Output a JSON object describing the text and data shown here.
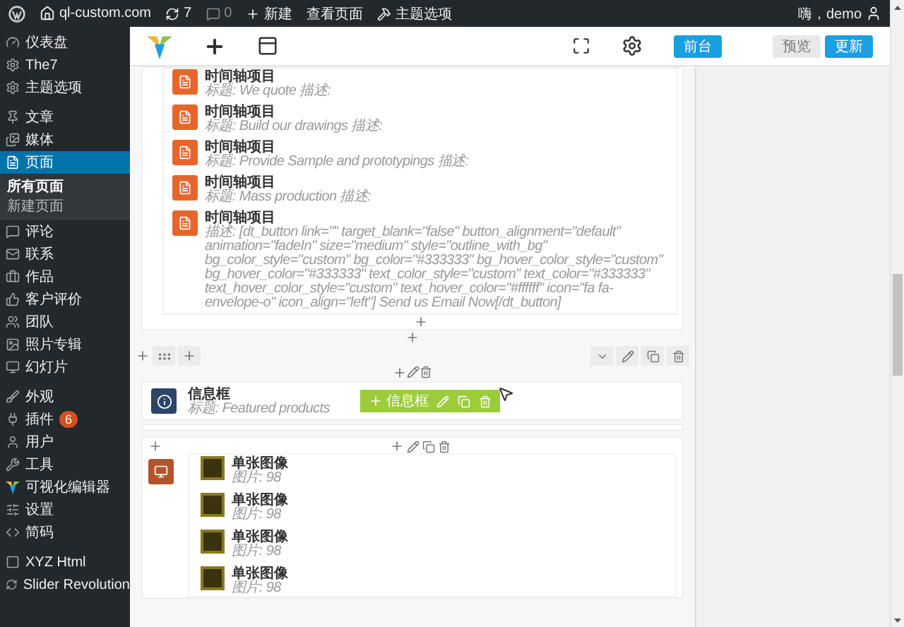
{
  "admin_bar": {
    "site": "ql-custom.com",
    "updates": "7",
    "comments": "0",
    "new": "新建",
    "view_page": "查看页面",
    "theme_options": "主题选项",
    "greeting": "嗨，demo"
  },
  "sidebar": {
    "groups": [
      {
        "items": [
          {
            "label": "仪表盘",
            "selected": false
          },
          {
            "label": "The7",
            "selected": false
          },
          {
            "label": "主题选项",
            "selected": false
          }
        ]
      },
      {
        "items": [
          {
            "label": "文章",
            "selected": false
          },
          {
            "label": "媒体",
            "selected": false
          },
          {
            "label": "页面",
            "selected": true,
            "children": [
              {
                "label": "所有页面",
                "selected": true
              },
              {
                "label": "新建页面",
                "selected": false
              }
            ]
          },
          {
            "label": "评论",
            "selected": false
          },
          {
            "label": "联系",
            "selected": false
          },
          {
            "label": "作品",
            "selected": false
          },
          {
            "label": "客户评价",
            "selected": false
          },
          {
            "label": "团队",
            "selected": false
          },
          {
            "label": "照片专辑",
            "selected": false
          },
          {
            "label": "幻灯片",
            "selected": false
          }
        ]
      },
      {
        "items": [
          {
            "label": "外观",
            "selected": false
          },
          {
            "label": "插件",
            "selected": false,
            "badge": "6"
          },
          {
            "label": "用户",
            "selected": false
          },
          {
            "label": "工具",
            "selected": false
          },
          {
            "label": "可视化编辑器",
            "selected": false
          },
          {
            "label": "设置",
            "selected": false
          },
          {
            "label": "简码",
            "selected": false
          }
        ]
      },
      {
        "items": [
          {
            "label": "XYZ Html",
            "selected": false
          },
          {
            "label": "Slider Revolution",
            "selected": false
          }
        ]
      }
    ]
  },
  "toolbar": {
    "buttons": [
      {
        "label": "前台",
        "kind": "primary"
      },
      {
        "label": "预览",
        "kind": "secondary"
      },
      {
        "label": "更新",
        "kind": "primary"
      }
    ]
  },
  "timeline_items": [
    {
      "title": "时间轴项目",
      "subtitle": "标题: We quote 描述:"
    },
    {
      "title": "时间轴项目",
      "subtitle": "标题: Build our drawings 描述:"
    },
    {
      "title": "时间轴项目",
      "subtitle": "标题: Provide Sample and prototypings 描述:"
    },
    {
      "title": "时间轴项目",
      "subtitle": "标题: Mass production 描述:"
    },
    {
      "title": "时间轴项目",
      "subtitle": "描述: [dt_button link=\"\" target_blank=\"false\" button_alignment=\"default\" animation=\"fadeIn\" size=\"medium\" style=\"outline_with_bg\" bg_color_style=\"custom\" bg_color=\"#333333\" bg_hover_color_style=\"custom\" bg_hover_color=\"#333333\" text_color_style=\"custom\" text_color=\"#333333\" text_hover_color_style=\"custom\" text_hover_color=\"#ffffff\" icon=\"fa fa-envelope-o\" icon_align=\"left\"] Send us Email Now[/dt_button]"
    }
  ],
  "info_box": {
    "title": "信息框",
    "subtitle": "标题: Featured products",
    "toolbar_label": "信息框"
  },
  "image_items": [
    {
      "title": "单张图像",
      "subtitle": "图片: 98"
    },
    {
      "title": "单张图像",
      "subtitle": "图片: 98"
    },
    {
      "title": "单张图像",
      "subtitle": "图片: 98"
    },
    {
      "title": "单张图像",
      "subtitle": "图片: 98"
    }
  ]
}
